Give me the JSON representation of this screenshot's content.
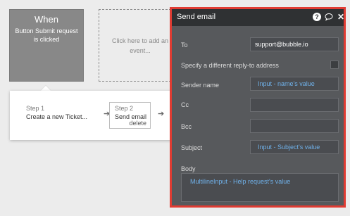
{
  "workflow": {
    "when_card": {
      "title": "When",
      "description": "Button Submit request is clicked"
    },
    "add_event_placeholder": "Click here to add an event...",
    "steps": [
      {
        "number": "Step 1",
        "name": "Create a new Ticket..."
      },
      {
        "number": "Step 2",
        "name": "Send email",
        "delete_label": "delete"
      }
    ],
    "arrow_glyph": "➔"
  },
  "panel": {
    "title": "Send email",
    "icons": [
      "help-icon",
      "comment-icon",
      "close-icon"
    ],
    "help_glyph": "?",
    "comment_glyph": "💬",
    "close_glyph": "✕",
    "accent_color": "#e03c33",
    "dynamic_value_color": "#6fb0e8",
    "fields": {
      "to": {
        "label": "To",
        "value": "support@bubble.io"
      },
      "reply_to": {
        "label": "Specify a different reply-to address",
        "checked": false
      },
      "sender_name": {
        "label": "Sender name",
        "value": "Input - name's value"
      },
      "cc": {
        "label": "Cc",
        "value": ""
      },
      "bcc": {
        "label": "Bcc",
        "value": ""
      },
      "subject": {
        "label": "Subject",
        "value": "Input - Subject's value"
      },
      "body": {
        "label": "Body",
        "value": "MultilineInput - Help request's value"
      }
    }
  }
}
